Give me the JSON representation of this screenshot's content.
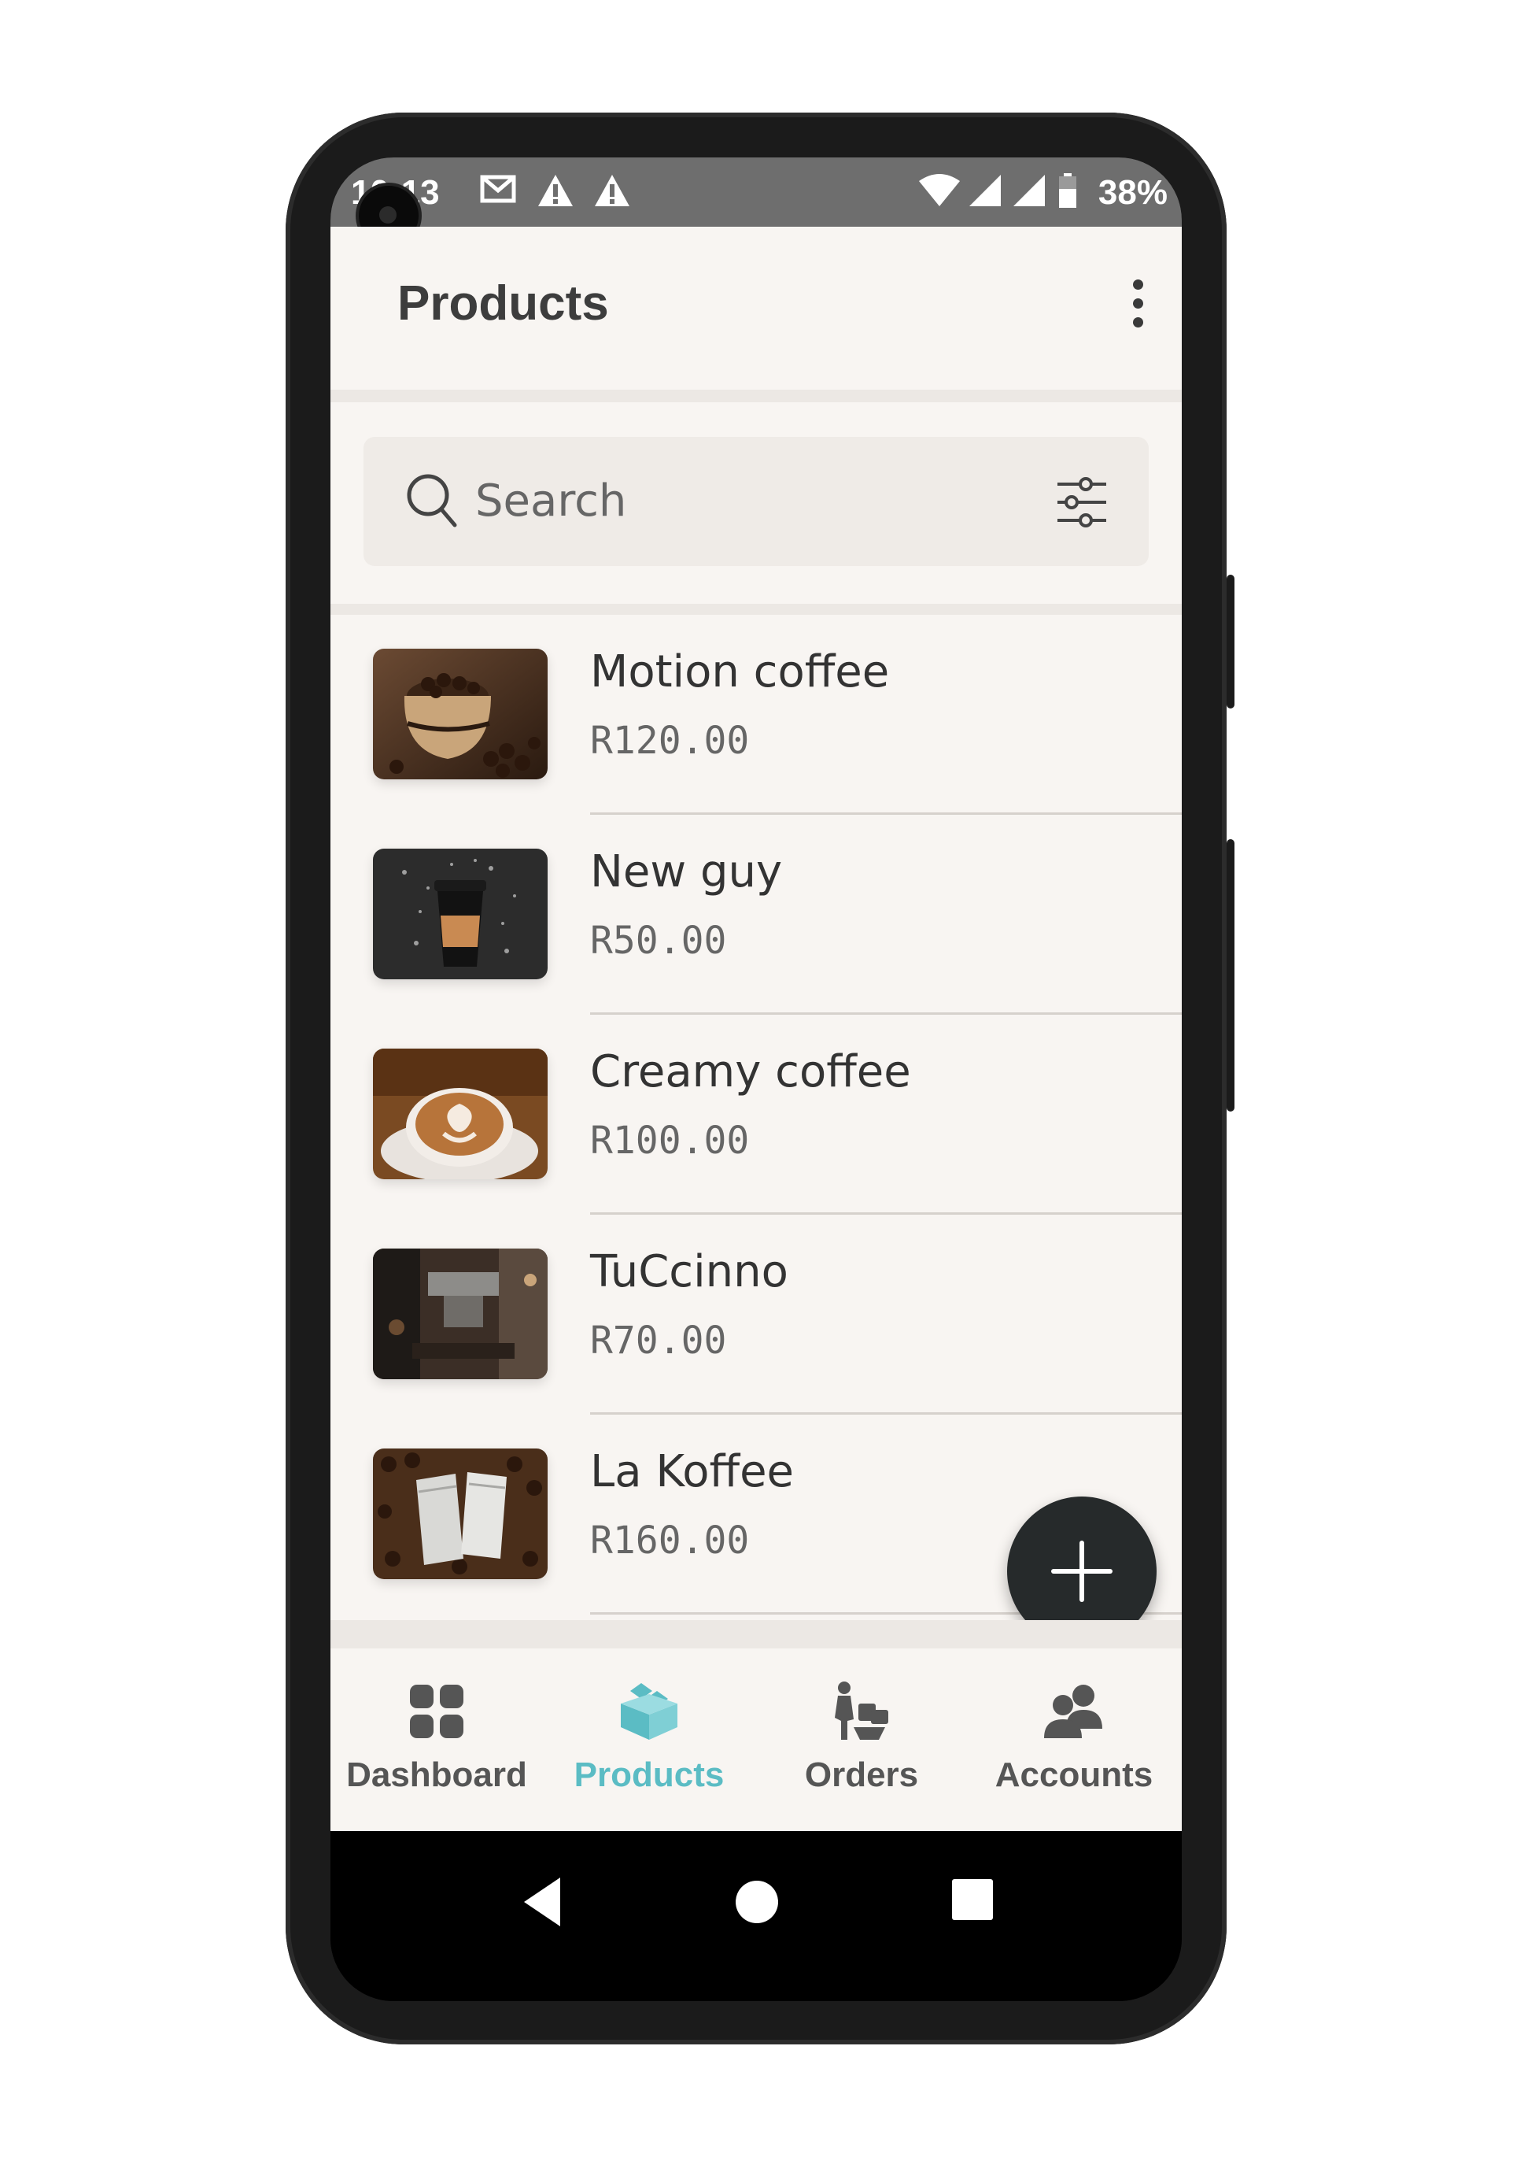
{
  "status_bar": {
    "time": "10:13",
    "battery": "38%",
    "icons": [
      "gmail-icon",
      "alert-icon",
      "alert-icon",
      "wifi-icon",
      "signal-icon",
      "signal-icon",
      "battery-icon"
    ]
  },
  "appbar": {
    "title": "Products",
    "menu_icon": "more-vert-icon"
  },
  "search": {
    "placeholder": "Search",
    "value": "",
    "icon": "search-icon",
    "filter_icon": "filter-sliders-icon"
  },
  "products": [
    {
      "name": "Motion coffee",
      "price": "R120.00"
    },
    {
      "name": "New guy",
      "price": "R50.00"
    },
    {
      "name": "Creamy coffee",
      "price": "R100.00"
    },
    {
      "name": "TuCcinno",
      "price": "R70.00"
    },
    {
      "name": "La Koffee",
      "price": "R160.00"
    }
  ],
  "fab": {
    "icon": "plus-icon"
  },
  "bottom_nav": {
    "items": [
      {
        "label": "Dashboard",
        "icon": "dashboard-icon"
      },
      {
        "label": "Products",
        "icon": "products-icon",
        "active": true
      },
      {
        "label": "Orders",
        "icon": "orders-icon"
      },
      {
        "label": "Accounts",
        "icon": "accounts-icon"
      }
    ]
  },
  "colors": {
    "accent": "#5bbcc4",
    "background": "#f8f5f2",
    "fab": "#262a2b"
  }
}
